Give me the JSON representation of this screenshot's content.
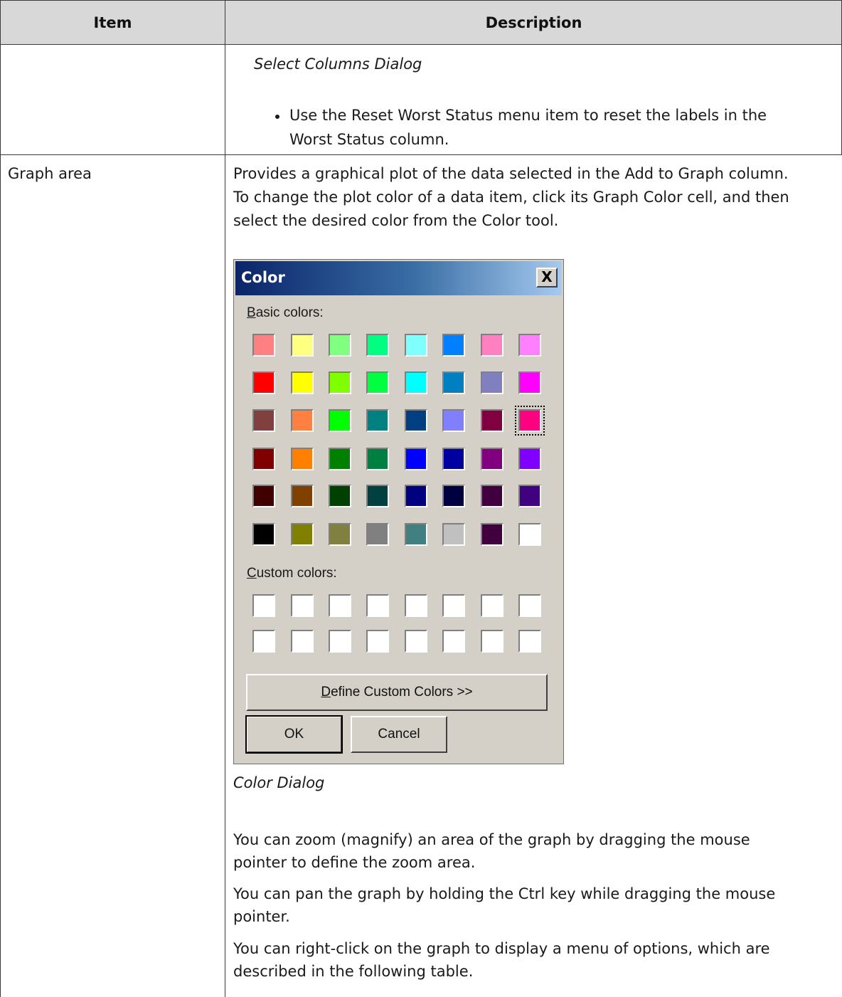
{
  "table": {
    "headers": {
      "item": "Item",
      "description": "Description"
    },
    "rows": [
      {
        "item": "",
        "caption": "Select Columns Dialog",
        "bullet": "Use the Reset Worst Status menu item to reset the labels in the",
        "bullet_cont": "Worst Status column."
      },
      {
        "item": "Graph area",
        "lines": [
          "Provides a graphical plot of the data selected in the Add to Graph column.",
          "To change the plot color of a data item, click its Graph Color cell, and then",
          "select the desired color from the Color tool."
        ],
        "figure_caption": "Color Dialog",
        "zoom_lines": [
          "You can zoom (magnify) an area of the graph by dragging the mouse",
          "pointer to define the zoom area."
        ],
        "pan_lines": [
          "You can pan the graph by holding the Ctrl key while dragging the mouse",
          "pointer."
        ],
        "menu_lines": [
          "You can right-click on the graph to display a menu of options, which are",
          "described in the following table."
        ]
      }
    ]
  },
  "color_dialog": {
    "title": "Color",
    "close_glyph": "X",
    "basic_label_hotkey": "B",
    "basic_label_rest": "asic colors:",
    "custom_label_hotkey": "C",
    "custom_label_rest": "ustom colors:",
    "define_hotkey": "D",
    "define_rest": "efine Custom Colors >>",
    "ok_label": "OK",
    "cancel_label": "Cancel",
    "selected_swatch": {
      "row": 2,
      "col": 7
    },
    "basic_colors": [
      [
        "#ff8080",
        "#ffff80",
        "#80ff80",
        "#00ff80",
        "#80ffff",
        "#0080ff",
        "#ff80c0",
        "#ff80ff"
      ],
      [
        "#ff0000",
        "#ffff00",
        "#80ff00",
        "#00ff40",
        "#00ffff",
        "#0080c0",
        "#8080c0",
        "#ff00ff"
      ],
      [
        "#804040",
        "#ff8040",
        "#00ff00",
        "#008080",
        "#004080",
        "#8080ff",
        "#800040",
        "#ff0080"
      ],
      [
        "#800000",
        "#ff8000",
        "#008000",
        "#008040",
        "#0000ff",
        "#0000a0",
        "#800080",
        "#8000ff"
      ],
      [
        "#400000",
        "#804000",
        "#004000",
        "#004040",
        "#000080",
        "#000040",
        "#400040",
        "#400080"
      ],
      [
        "#000000",
        "#808000",
        "#808040",
        "#808080",
        "#408080",
        "#c0c0c0",
        "#400040",
        "#ffffff"
      ]
    ],
    "custom_colors": [
      [
        "#ffffff",
        "#ffffff",
        "#ffffff",
        "#ffffff",
        "#ffffff",
        "#ffffff",
        "#ffffff",
        "#ffffff"
      ],
      [
        "#ffffff",
        "#ffffff",
        "#ffffff",
        "#ffffff",
        "#ffffff",
        "#ffffff",
        "#ffffff",
        "#ffffff"
      ]
    ]
  }
}
